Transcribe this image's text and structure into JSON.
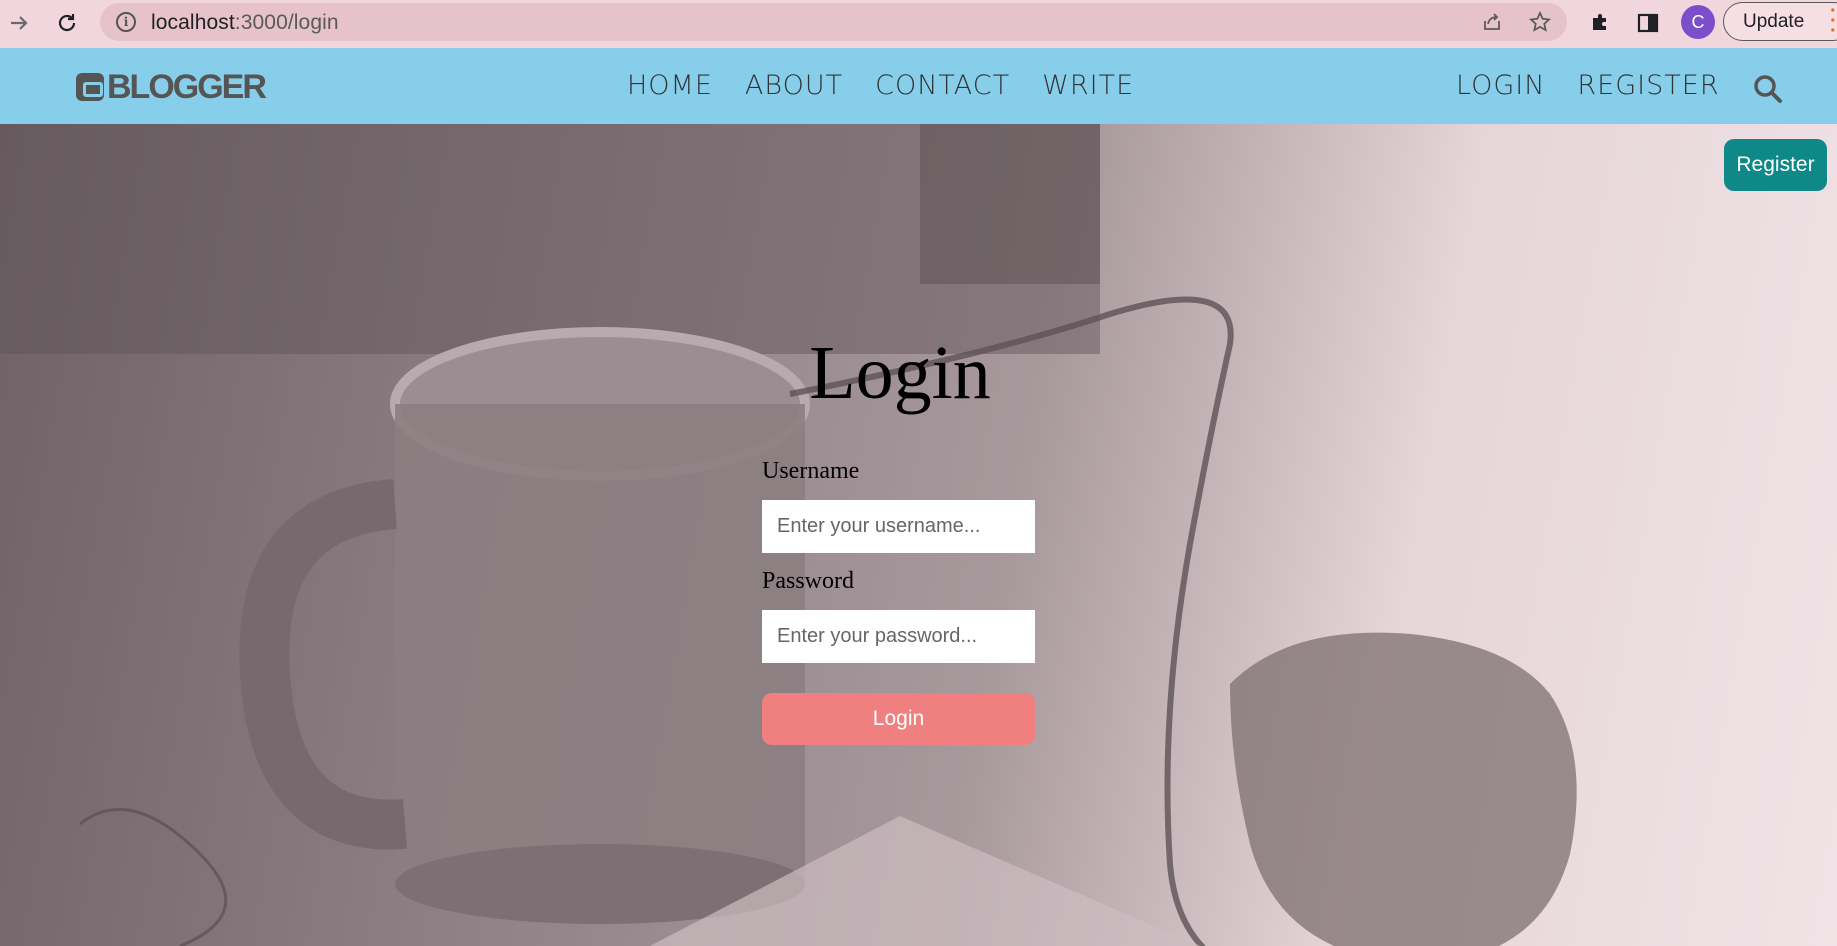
{
  "browser": {
    "url_host": "localhost",
    "url_path": ":3000/login",
    "profile_initial": "C",
    "update_label": "Update"
  },
  "site": {
    "logo_text": "BLOGGER",
    "nav_center": [
      "HOME",
      "ABOUT",
      "CONTACT",
      "WRITE"
    ],
    "nav_right": [
      "LOGIN",
      "REGISTER"
    ]
  },
  "page": {
    "register_button": "Register",
    "title": "Login",
    "username_label": "Username",
    "username_placeholder": "Enter your username...",
    "password_label": "Password",
    "password_placeholder": "Enter your password...",
    "login_button": "Login"
  },
  "colors": {
    "nav_bg": "#87ceeb",
    "register_bg": "#0f8888",
    "login_btn_bg": "#f08080"
  }
}
